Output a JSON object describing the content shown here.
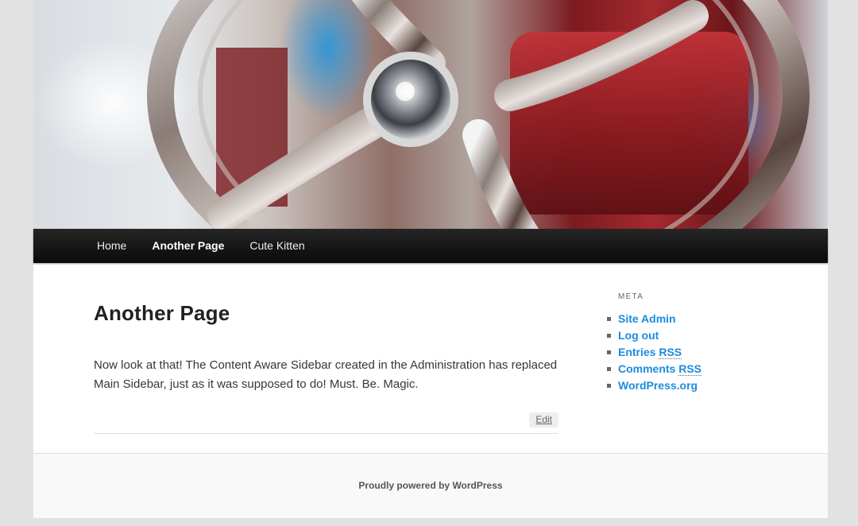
{
  "nav": {
    "items": [
      {
        "label": "Home"
      },
      {
        "label": "Another Page"
      },
      {
        "label": "Cute Kitten"
      }
    ]
  },
  "main": {
    "title": "Another Page",
    "content": "Now look at that! The Content Aware Sidebar created in the Administration has replaced Main Sidebar, just as it was supposed to do! Must. Be. Magic.",
    "edit_label": "Edit"
  },
  "sidebar": {
    "widget_title": "Meta",
    "links": [
      {
        "label": "Site Admin"
      },
      {
        "label": "Log out"
      },
      {
        "label_prefix": "Entries ",
        "abbr": "RSS"
      },
      {
        "label_prefix": "Comments ",
        "abbr": "RSS"
      },
      {
        "label": "WordPress.org"
      }
    ]
  },
  "footer": {
    "credit": "Proudly powered by WordPress"
  },
  "colors": {
    "link": "#1b8be0",
    "nav_bg": "#1a1a1a",
    "page_bg": "#e2e2e2"
  }
}
